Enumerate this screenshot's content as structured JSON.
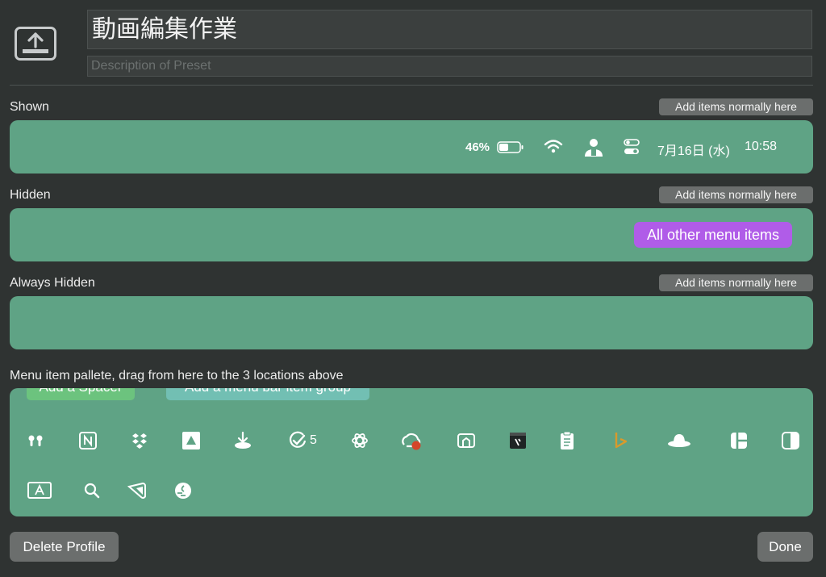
{
  "profile": {
    "title": "動画編集作業",
    "description_placeholder": "Description of Preset",
    "icon": "upload-tray-icon"
  },
  "sections": {
    "shown": {
      "label": "Shown",
      "add_button": "Add items normally here"
    },
    "hidden": {
      "label": "Hidden",
      "add_button": "Add items normally here",
      "pill": "All other menu items"
    },
    "always_hidden": {
      "label": "Always Hidden",
      "add_button": "Add items normally here"
    }
  },
  "status_bar": {
    "battery_percent": "46%",
    "battery_level": 0.46,
    "date": "7月16日 (水)",
    "time": "10:58",
    "icons": [
      "battery-icon",
      "wifi-icon",
      "user-icon",
      "control-center-icon"
    ]
  },
  "palette": {
    "label": "Menu item pallete, drag from here to the 3 locations above",
    "add_spacer": "Add a Spacer",
    "add_group": "Add a menu bar item group",
    "reminder_count": "5",
    "row1_icons": [
      "airpods-icon",
      "notion-icon",
      "dropbox-icon",
      "google-drive-icon",
      "download-tray-icon",
      "checkmark-count-icon",
      "chatgpt-icon",
      "creative-cloud-icon",
      "screen-share-icon",
      "notes-app-icon",
      "clipboard-icon",
      "bing-icon",
      "hat-icon",
      "layout-grid-icon",
      "half-panel-icon"
    ],
    "row2_icons": [
      "input-source-icon",
      "spotlight-search-icon",
      "wedge-icon",
      "globe-icon"
    ]
  },
  "buttons": {
    "delete": "Delete Profile",
    "done": "Done"
  },
  "colors": {
    "background": "#2f3332",
    "zone": "#5fa385",
    "accent_pill": "#b05ce8",
    "button": "#6b6e6d"
  }
}
